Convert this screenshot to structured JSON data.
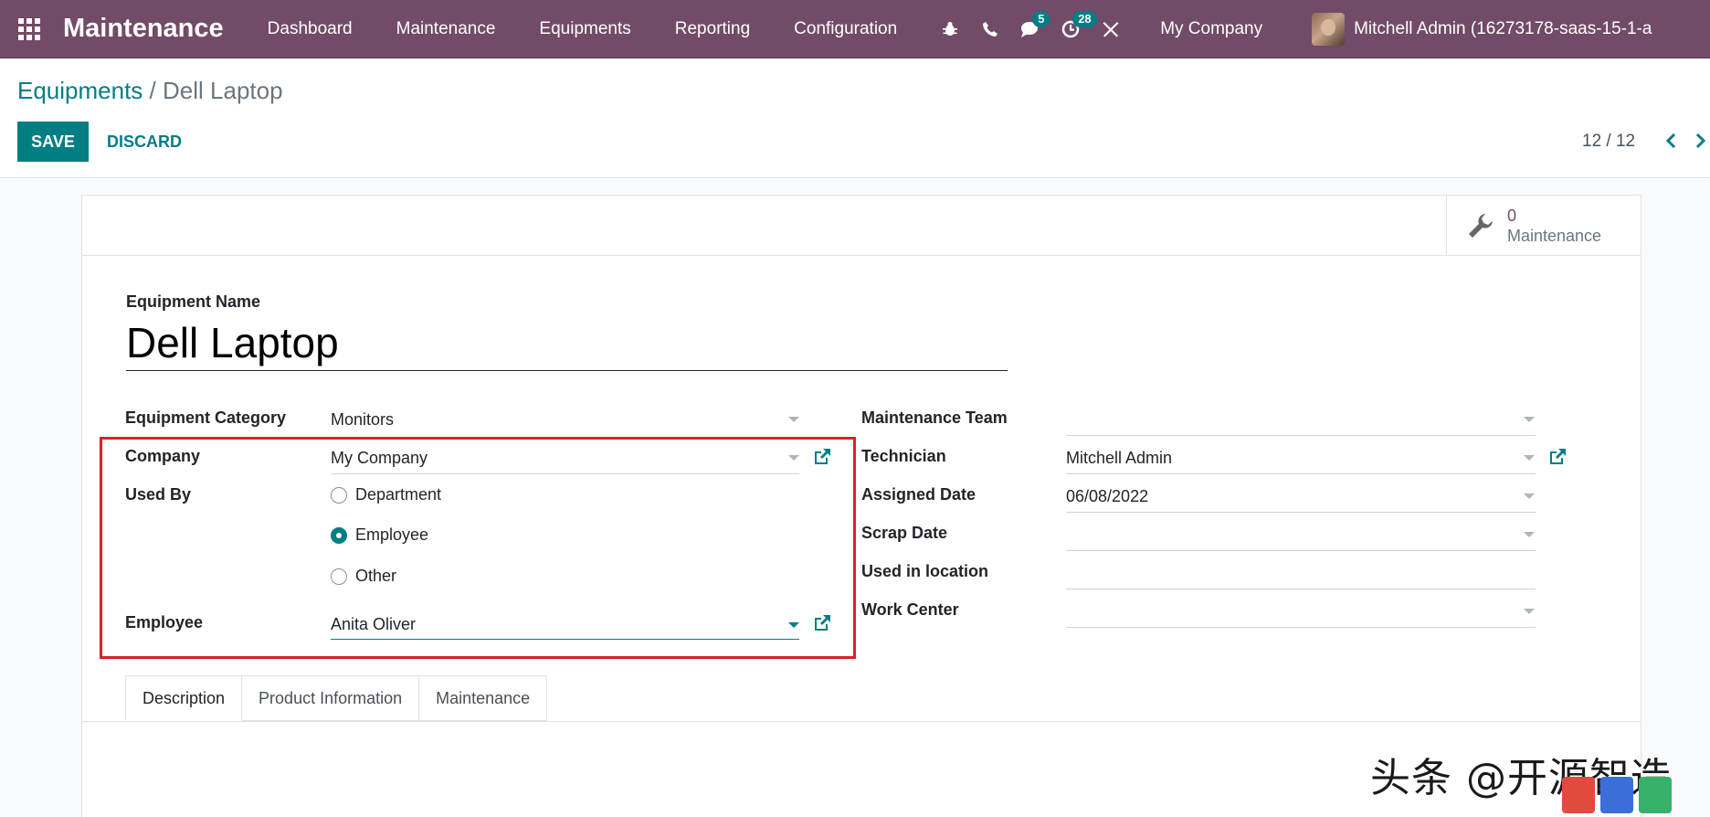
{
  "navbar": {
    "app_title": "Maintenance",
    "menu": [
      "Dashboard",
      "Maintenance",
      "Equipments",
      "Reporting",
      "Configuration"
    ],
    "messages_count": "5",
    "activities_count": "28",
    "company": "My Company",
    "user": "Mitchell Admin (16273178-saas-15-1-a",
    "icons": [
      "apps-icon",
      "bug-icon",
      "phone-icon",
      "chat-icon",
      "clock-icon",
      "tools-icon"
    ]
  },
  "control": {
    "breadcrumb_parent": "Equipments",
    "breadcrumb_sep": "/",
    "breadcrumb_current": "Dell Laptop",
    "save_label": "SAVE",
    "discard_label": "DISCARD",
    "pager": "12 / 12"
  },
  "stat_button": {
    "value": "0",
    "label": "Maintenance",
    "icon": "wrench-icon"
  },
  "form": {
    "name_label": "Equipment Name",
    "name_value": "Dell Laptop",
    "left": {
      "category_label": "Equipment Category",
      "category_value": "Monitors",
      "company_label": "Company",
      "company_value": "My Company",
      "used_by_label": "Used By",
      "used_by_options": [
        "Department",
        "Employee",
        "Other"
      ],
      "used_by_selected": "Employee",
      "employee_label": "Employee",
      "employee_value": "Anita Oliver"
    },
    "right": {
      "team_label": "Maintenance Team",
      "team_value": "",
      "technician_label": "Technician",
      "technician_value": "Mitchell Admin",
      "assigned_label": "Assigned Date",
      "assigned_value": "06/08/2022",
      "scrap_label": "Scrap Date",
      "scrap_value": "",
      "location_label": "Used in location",
      "location_value": "",
      "workcenter_label": "Work Center",
      "workcenter_value": ""
    }
  },
  "tabs": [
    "Description",
    "Product Information",
    "Maintenance"
  ],
  "active_tab": "Description",
  "watermark": "头条 @开源智造",
  "colors": {
    "brand": "#714b67",
    "accent": "#017e84",
    "highlight": "#d9222a"
  }
}
